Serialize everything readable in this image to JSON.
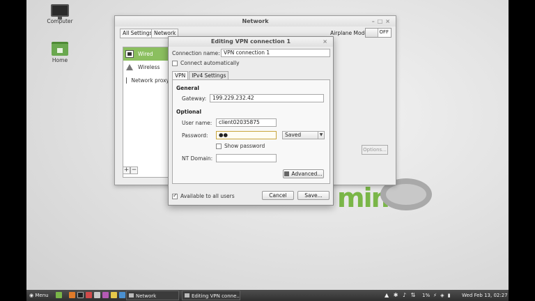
{
  "desktop": {
    "icons": [
      {
        "label": "Computer",
        "icon": "computer-icon"
      },
      {
        "label": "Home",
        "icon": "home-folder-icon"
      }
    ]
  },
  "network_window": {
    "title": "Network",
    "breadcrumb": [
      "All Settings",
      "Network"
    ],
    "airplane_mode_label": "Airplane Mode",
    "airplane_toggle": "OFF",
    "list_items": [
      {
        "label": "Wired",
        "selected": true
      },
      {
        "label": "Wireless",
        "selected": false
      },
      {
        "label": "Network proxy",
        "selected": false
      }
    ],
    "add_label": "+",
    "remove_label": "−",
    "options_label": "Options..."
  },
  "vpn_dialog": {
    "title": "Editing VPN connection 1",
    "close_label": "×",
    "connection_name_label": "Connection name:",
    "connection_name_value": "VPN connection 1",
    "connect_auto_label": "Connect automatically",
    "connect_auto_checked": false,
    "tabs": [
      {
        "label": "VPN",
        "active": true
      },
      {
        "label": "IPv4 Settings",
        "active": false
      }
    ],
    "general_heading": "General",
    "gateway_label": "Gateway:",
    "gateway_value": "199.229.232.42",
    "optional_heading": "Optional",
    "username_label": "User name:",
    "username_value": "client02035875",
    "password_label": "Password:",
    "password_value": "●●",
    "password_storage": "Saved",
    "show_password_label": "Show password",
    "nt_domain_label": "NT Domain:",
    "nt_domain_value": "",
    "advanced_label": "Advanced...",
    "available_all_label": "Available to all users",
    "available_all_checked": true,
    "cancel_label": "Cancel",
    "save_label": "Save..."
  },
  "taskbar": {
    "menu_label": "Menu",
    "tasks": [
      {
        "label": "Network"
      },
      {
        "label": "Editing VPN conne..."
      }
    ],
    "battery": "1%",
    "clock": "Wed Feb 13, 02:27"
  },
  "colors": {
    "selection": "#8bbf5f",
    "mint_green": "#7ab648"
  }
}
